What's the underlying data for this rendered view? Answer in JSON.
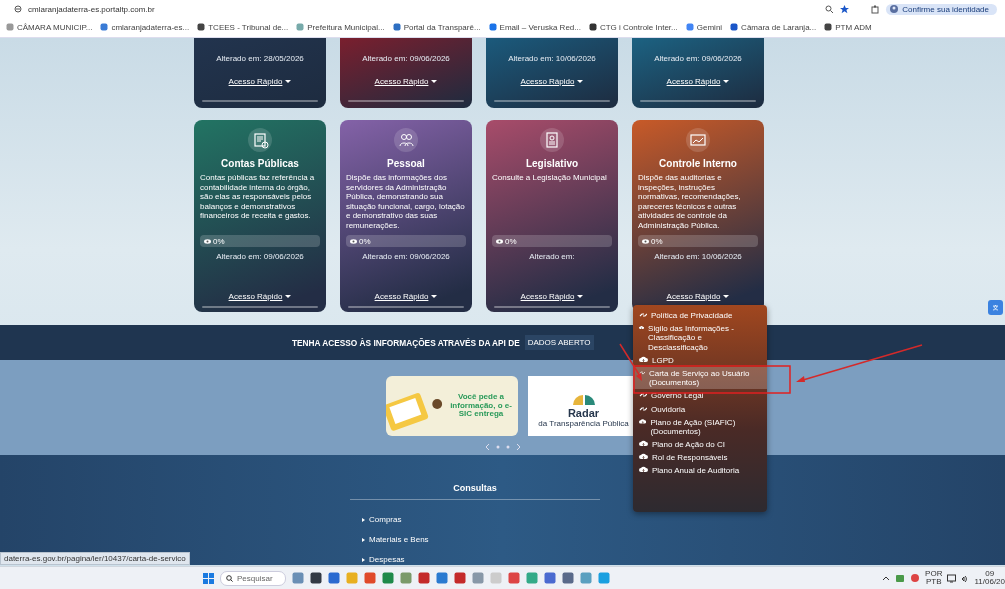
{
  "browser": {
    "url": "cmlaranjadaterra-es.portaltp.com.br",
    "profile_button": "Confirme sua identidade",
    "bookmarks": [
      {
        "label": "CÂMARA MUNICIP..."
      },
      {
        "label": "cmlaranjadaterra-es..."
      },
      {
        "label": "TCEES - Tribunal de..."
      },
      {
        "label": "Prefeitura Municipal..."
      },
      {
        "label": "Portal da Transparê..."
      },
      {
        "label": "Email – Veruska Red..."
      },
      {
        "label": "CTG i Controle Inter..."
      },
      {
        "label": "Gemini"
      },
      {
        "label": "Câmara de Laranja..."
      },
      {
        "label": "PTM ADM"
      }
    ]
  },
  "cards_top": [
    {
      "updated": "Alterado em: 28/05/2026",
      "quick_access": "Acesso Rápido",
      "color": "#22344e"
    },
    {
      "updated": "Alterado em: 09/06/2026",
      "quick_access": "Acesso Rápido",
      "color": "#7a1f2e"
    },
    {
      "updated": "Alterado em: 10/06/2026",
      "quick_access": "Acesso Rápido",
      "color": "#1b5a7c"
    },
    {
      "updated": "Alterado em: 09/06/2026",
      "quick_access": "Acesso Rápido",
      "color": "#1c6282"
    }
  ],
  "cards": [
    {
      "title": "Contas Públicas",
      "description": "Contas públicas faz referência a contabilidade interna do órgão, são elas as responsáveis pelos balanços e demonstrativos financeiros de receita e gastos.",
      "views": "0%",
      "updated": "Alterado em: 09/06/2026",
      "quick_access": "Acesso Rápido",
      "color": "#227463"
    },
    {
      "title": "Pessoal",
      "description": "Dispõe das informações dos servidores da Administração Pública, demonstrando sua situação funcional, cargo, lotação e demonstrativo das suas remunerações.",
      "views": "0%",
      "updated": "Alterado em: 09/06/2026",
      "quick_access": "Acesso Rápido",
      "color": "#8462a8"
    },
    {
      "title": "Legislativo",
      "description": "Consulte a Legislação Municipal",
      "views": "0%",
      "updated": "Alterado em:",
      "quick_access": "Acesso Rápido",
      "color": "#a84c6a"
    },
    {
      "title": "Controle Interno",
      "description": "Dispõe das auditorias e inspeções, instruções normativas, recomendações, pareceres técnicos e outras atividades de controle da Administração Pública.",
      "views": "0%",
      "updated": "Alterado em: 10/06/2026",
      "quick_access": "Acesso Rápido",
      "color": "#c85a28"
    }
  ],
  "quick_menu": {
    "items": [
      {
        "label": "Política de Privacidade",
        "kind": "link",
        "selected": false
      },
      {
        "label": "Sigilo das Informações - Classificação e Desclassificação",
        "kind": "download",
        "selected": false
      },
      {
        "label": "LGPD",
        "kind": "download",
        "selected": false
      },
      {
        "label": "Carta de Serviço ao Usuário (Documentos)",
        "kind": "link",
        "selected": true
      },
      {
        "label": "Governo Legal",
        "kind": "link",
        "selected": false
      },
      {
        "label": "Ouvidoria",
        "kind": "link",
        "selected": false
      },
      {
        "label": "Plano de Ação (SIAFIC) (Documentos)",
        "kind": "download",
        "selected": false
      },
      {
        "label": "Plano de Ação do CI",
        "kind": "download",
        "selected": false
      },
      {
        "label": "Rol de Responsáveis",
        "kind": "download",
        "selected": false
      },
      {
        "label": "Plano Anual de Auditoria",
        "kind": "download",
        "selected": false
      }
    ]
  },
  "api_banner": {
    "text": "TENHA ACESSO ÀS INFORMAÇÕES ATRAVÉS DA API DE",
    "button": "DADOS ABERTO"
  },
  "carousel": {
    "slides": [
      {
        "kind": "esic",
        "text": "Você pede a informação, o e-SIC entrega"
      },
      {
        "kind": "radar",
        "title": "Radar",
        "subtitle": "da Transparência Pública"
      }
    ]
  },
  "footer": {
    "heading": "Consultas",
    "links": [
      "Compras",
      "Materiais e Bens",
      "Despesas"
    ]
  },
  "status_url": "daterra-es.gov.br/pagina/ler/10437/carta-de-servico",
  "taskbar": {
    "search_placeholder": "Pesquisar",
    "language": "POR",
    "layout": "PTB",
    "time": "09",
    "date": "11/06/20"
  }
}
